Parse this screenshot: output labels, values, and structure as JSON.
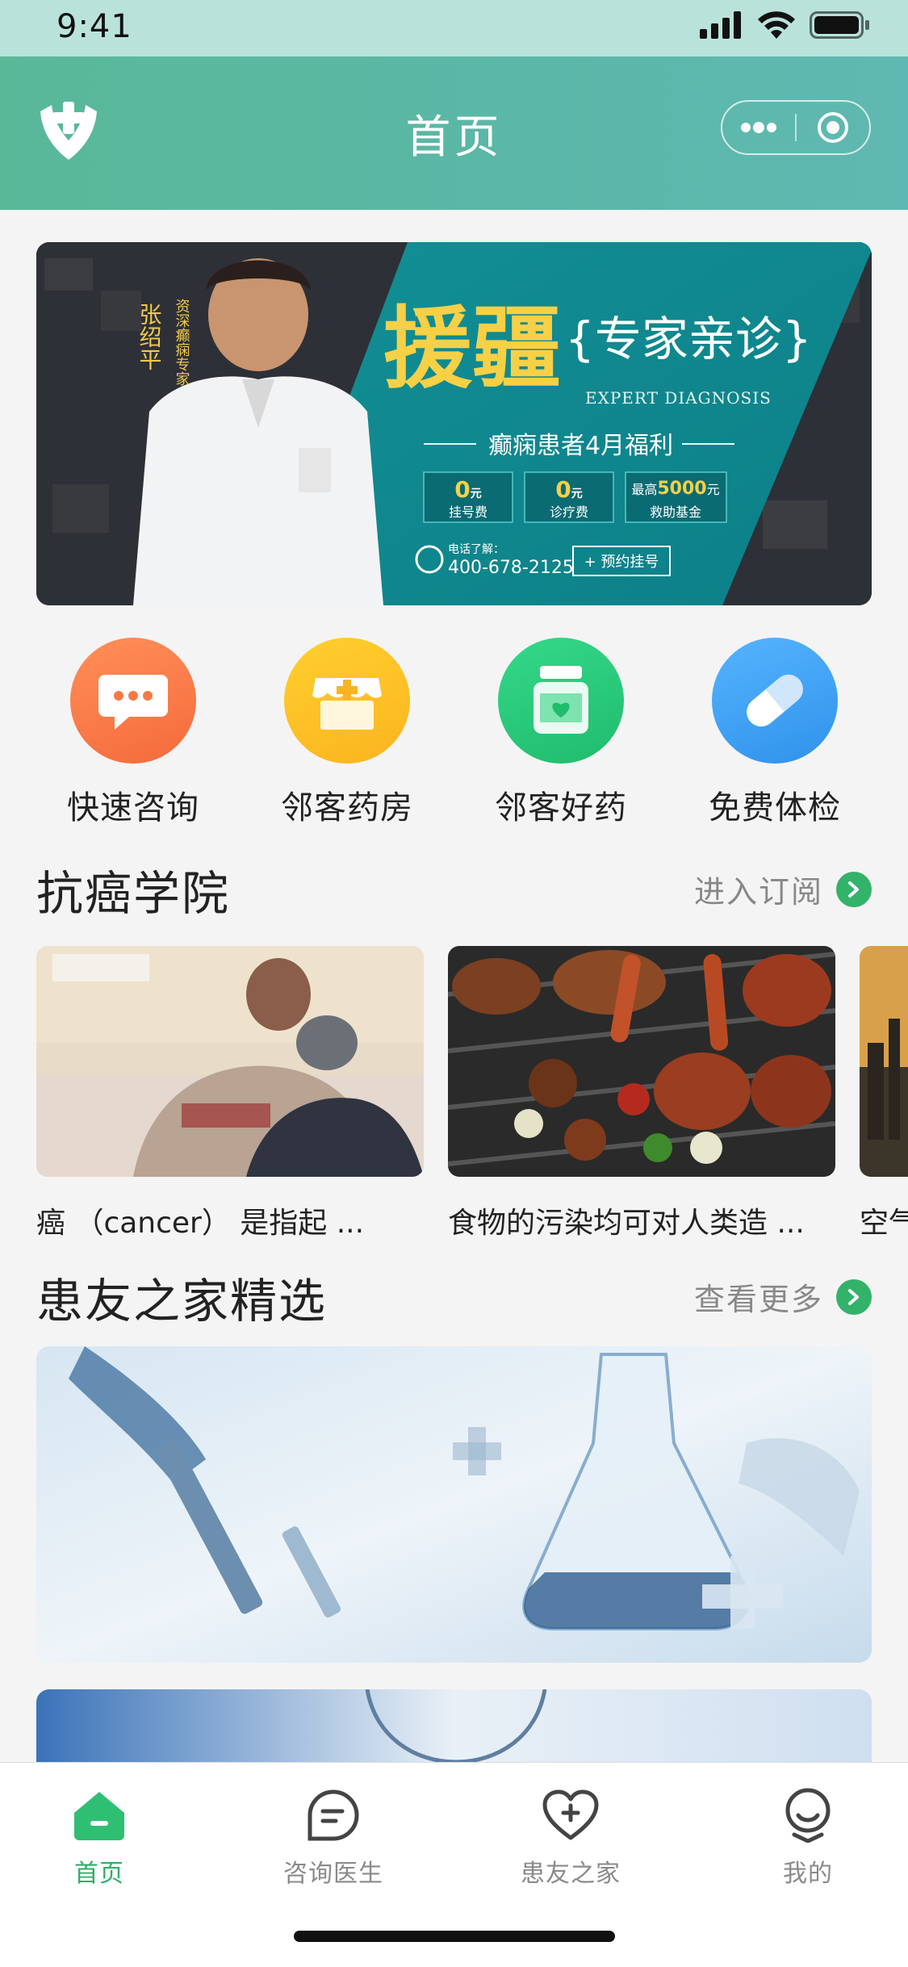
{
  "status_bar": {
    "time": "9:41"
  },
  "header": {
    "title": "首页"
  },
  "banner": {
    "doctor_name": "张绍平",
    "doctor_title": "资深癫痫专家",
    "headline": "援疆",
    "subtitle": "专家亲诊",
    "subtitle_en": "EXPERT DIAGNOSIS",
    "benefit_line": "癫痫患者4月福利",
    "offers": [
      {
        "value": "0",
        "unit": "元",
        "label": "挂号费"
      },
      {
        "value": "0",
        "unit": "元",
        "label": "诊疗费"
      },
      {
        "prefix": "最高",
        "value": "5000",
        "unit": "元",
        "label": "救助基金"
      }
    ],
    "phone_label": "电话了解：",
    "phone": "400-678-2125",
    "cta": "+ 预约挂号"
  },
  "quick_actions": [
    {
      "label": "快速咨询",
      "icon": "chat-bubble-icon",
      "color": "#f97a45"
    },
    {
      "label": "邻客药房",
      "icon": "pharmacy-store-icon",
      "color": "#fdbb24"
    },
    {
      "label": "邻客好药",
      "icon": "medicine-bottle-icon",
      "color": "#22c577"
    },
    {
      "label": "免费体检",
      "icon": "pill-capsule-icon",
      "color": "#3fa2f2"
    }
  ],
  "sections": {
    "academy": {
      "title": "抗癌学院",
      "more": "进入订阅"
    },
    "community": {
      "title": "患友之家精选",
      "more": "查看更多"
    }
  },
  "articles": [
    {
      "title": "癌 （cancer） 是指起 ...",
      "image": "patient-care-photo"
    },
    {
      "title": "食物的污染均可对人类造 ...",
      "image": "grilled-meat-photo"
    },
    {
      "title": "空气",
      "image": "air-pollution-photo"
    }
  ],
  "tabbar": [
    {
      "label": "首页",
      "icon": "home-icon",
      "active": true
    },
    {
      "label": "咨询医生",
      "icon": "consult-doctor-icon",
      "active": false
    },
    {
      "label": "患友之家",
      "icon": "heart-plus-icon",
      "active": false
    },
    {
      "label": "我的",
      "icon": "profile-icon",
      "active": false
    }
  ],
  "colors": {
    "header": "#5bb7a8",
    "accent_green": "#2fae6a",
    "tab_inactive": "#8a8a8a"
  }
}
